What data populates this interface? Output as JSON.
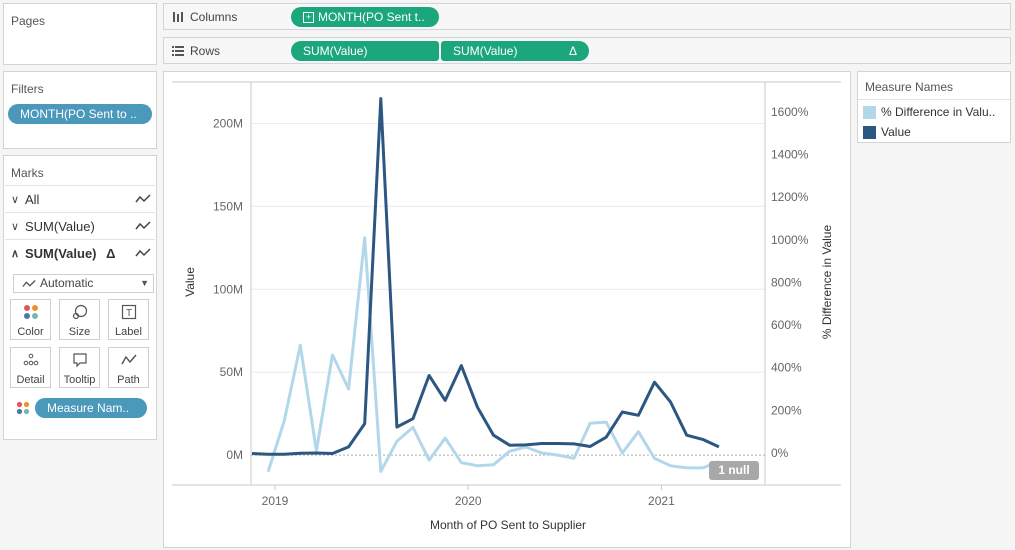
{
  "pages": {
    "title": "Pages"
  },
  "columns": {
    "label": "Columns",
    "pill": "MONTH(PO Sent t.."
  },
  "rows": {
    "label": "Rows",
    "pill1": "SUM(Value)",
    "pill2": "SUM(Value)",
    "pill2_badge": "Δ"
  },
  "filters": {
    "title": "Filters",
    "pill": "MONTH(PO Sent to .."
  },
  "marks": {
    "title": "Marks",
    "cards": [
      {
        "label": "All",
        "expanded": false
      },
      {
        "label": "SUM(Value)",
        "expanded": false
      },
      {
        "label": "SUM(Value)",
        "badge": "Δ",
        "expanded": true
      }
    ],
    "mark_type": "Automatic",
    "buttons": [
      "Color",
      "Size",
      "Label",
      "Detail",
      "Tooltip",
      "Path"
    ],
    "field_pill": "Measure Nam.."
  },
  "legend": {
    "title": "Measure Names",
    "items": [
      {
        "label": "% Difference in Valu..",
        "color": "#b3d7ea"
      },
      {
        "label": "Value",
        "color": "#2c5780"
      }
    ]
  },
  "null_badge": "1 null",
  "chart_data": {
    "type": "line",
    "xlabel": "Month of PO Sent to Supplier",
    "ylabel_left": "Value",
    "ylabel_right": "% Difference in Value",
    "x_ticks": [
      "2019",
      "2020",
      "2021"
    ],
    "y_left_ticks": [
      "0M",
      "50M",
      "100M",
      "150M",
      "200M"
    ],
    "y_left_range": [
      -18,
      225
    ],
    "y_right_ticks": [
      "0%",
      "200%",
      "400%",
      "600%",
      "800%",
      "1000%",
      "1200%",
      "1400%",
      "1600%"
    ],
    "y_right_range": [
      -150,
      1740
    ],
    "months": [
      "2019-01",
      "2019-02",
      "2019-03",
      "2019-04",
      "2019-05",
      "2019-06",
      "2019-07",
      "2019-08",
      "2019-09",
      "2019-10",
      "2019-11",
      "2019-12",
      "2020-01",
      "2020-02",
      "2020-03",
      "2020-04",
      "2020-05",
      "2020-06",
      "2020-07",
      "2020-08",
      "2020-09",
      "2020-10",
      "2020-11",
      "2020-12",
      "2021-01",
      "2021-02",
      "2021-03",
      "2021-04",
      "2021-05",
      "2021-06"
    ],
    "series": [
      {
        "name": "Value",
        "color": "#2c5780",
        "values": [
          1,
          0.5,
          0.5,
          1.2,
          1.3,
          1,
          5,
          19,
          215,
          17,
          22,
          48,
          33,
          54,
          29,
          12,
          6,
          6.2,
          7,
          7,
          6.8,
          5.2,
          10.8,
          26,
          24,
          44,
          32,
          12,
          9.5,
          5
        ]
      },
      {
        "name": "% Difference in Value",
        "color": "#b3d7ea",
        "values": [
          null,
          -88,
          150,
          505,
          10,
          460,
          300,
          1010,
          -86,
          55,
          120,
          -33,
          70,
          -45,
          -60,
          -55,
          8,
          28,
          0,
          -10,
          -25,
          140,
          145,
          0,
          100,
          -25,
          -60,
          -70,
          -70,
          -40
        ]
      }
    ]
  }
}
